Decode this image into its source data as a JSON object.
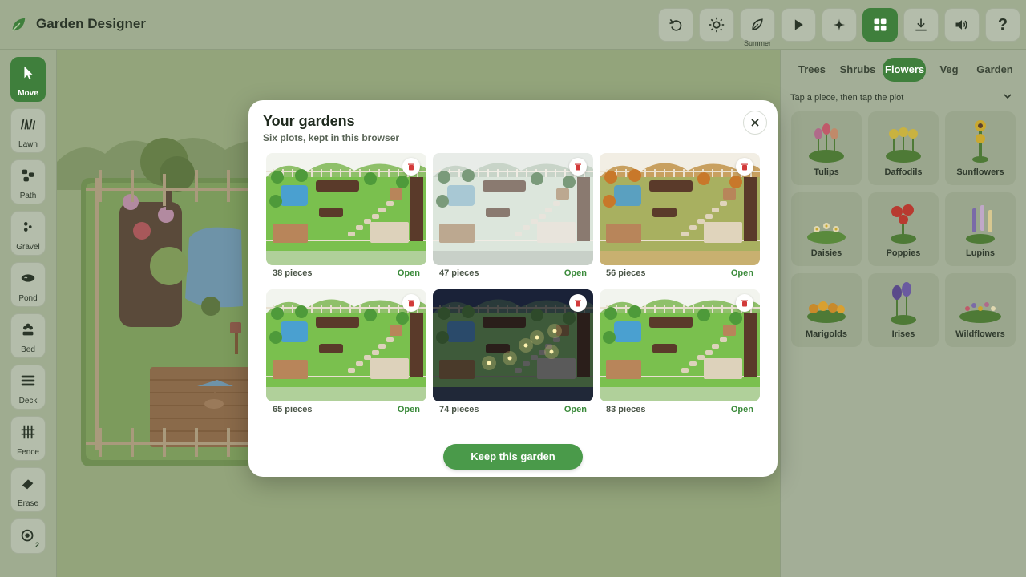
{
  "app": {
    "title": "Garden Designer"
  },
  "header": {
    "buttons": [
      {
        "name": "undo",
        "icon": "undo-icon"
      },
      {
        "name": "daylight",
        "icon": "sun-icon"
      },
      {
        "name": "season",
        "icon": "leaf-icon",
        "label": "Summer"
      },
      {
        "name": "play",
        "icon": "play-icon"
      },
      {
        "name": "sparkle",
        "icon": "sparkle-icon"
      },
      {
        "name": "gallery",
        "icon": "grid-icon",
        "active": true
      },
      {
        "name": "download",
        "icon": "download-icon"
      },
      {
        "name": "sound",
        "icon": "speaker-icon"
      },
      {
        "name": "help",
        "icon": "help-icon",
        "label": "?"
      }
    ]
  },
  "tools": [
    {
      "label": "Move",
      "icon": "cursor-icon",
      "active": true
    },
    {
      "label": "Lawn",
      "icon": "grass-icon"
    },
    {
      "label": "Path",
      "icon": "stepping-stones-icon"
    },
    {
      "label": "Gravel",
      "icon": "gravel-icon"
    },
    {
      "label": "Pond",
      "icon": "pond-icon"
    },
    {
      "label": "Bed",
      "icon": "flower-bed-icon"
    },
    {
      "label": "Deck",
      "icon": "deck-icon"
    },
    {
      "label": "Fence",
      "icon": "fence-icon"
    },
    {
      "label": "Erase",
      "icon": "eraser-icon"
    },
    {
      "label": "",
      "icon": "target-icon",
      "badge": "2"
    }
  ],
  "panel": {
    "tabs": [
      "Trees",
      "Shrubs",
      "Flowers",
      "Veg",
      "Garden"
    ],
    "active_tab": "Flowers",
    "hint": "Tap a piece, then tap the plot",
    "pieces": [
      "Tulips",
      "Daffodils",
      "Sunflowers",
      "Daisies",
      "Poppies",
      "Lupins",
      "Marigolds",
      "Irises",
      "Wildflowers"
    ]
  },
  "modal": {
    "title": "Your gardens",
    "subtitle": "Six plots, kept in this browser",
    "close_icon": "close-icon",
    "delete_icon": "trash-icon",
    "open_label": "Open",
    "gardens": [
      {
        "pieces": "38 pieces",
        "theme": "summer"
      },
      {
        "pieces": "47 pieces",
        "theme": "winter"
      },
      {
        "pieces": "56 pieces",
        "theme": "autumn"
      },
      {
        "pieces": "65 pieces",
        "theme": "summer"
      },
      {
        "pieces": "74 pieces",
        "theme": "night"
      },
      {
        "pieces": "83 pieces",
        "theme": "summer"
      }
    ],
    "keep_label": "Keep this garden"
  },
  "colors": {
    "accent": "#3f7f3c",
    "keep_button": "#4a9a4a",
    "open_link": "#3a8a3a",
    "delete_icon": "#d23a3a"
  }
}
